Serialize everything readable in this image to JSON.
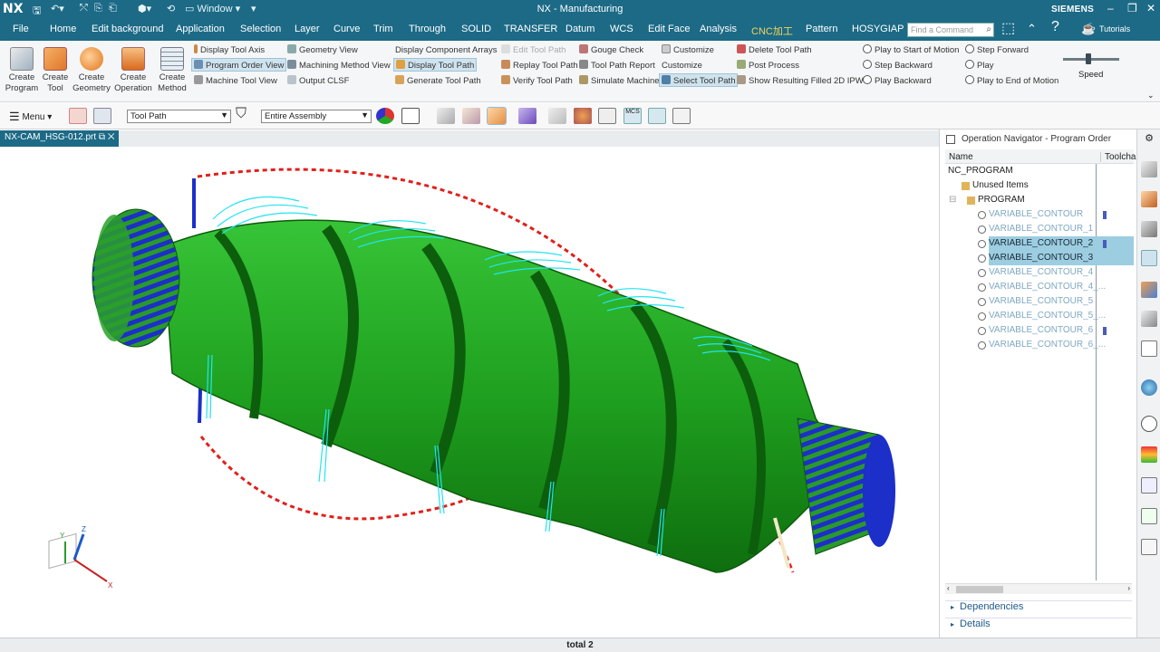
{
  "titlebar": {
    "logo": "NX",
    "window_menu": "Window",
    "title": "NX - Manufacturing",
    "brand": "SIEMENS"
  },
  "menubar": {
    "items": [
      "File",
      "Home",
      "Edit background",
      "Application",
      "Selection",
      "Layer",
      "Curve",
      "Trim",
      "Through",
      "SOLID",
      "TRANSFER",
      "Datum",
      "WCS",
      "Edit Face",
      "Analysis",
      "CNC加工",
      "Pattern",
      "HOSYGIAP"
    ],
    "active": "CNC加工",
    "search_placeholder": "Find a Command",
    "tutorials": "Tutorials"
  },
  "ribbon": {
    "create_program": [
      "Create",
      "Program"
    ],
    "create_tool": [
      "Create",
      "Tool"
    ],
    "create_geometry": [
      "Create",
      "Geometry"
    ],
    "create_operation": [
      "Create",
      "Operation"
    ],
    "create_method": [
      "Create",
      "Method"
    ],
    "display_tool_axis": "Display Tool Axis",
    "program_order_view": "Program Order View",
    "machine_tool_view": "Machine Tool View",
    "geometry_view": "Geometry View",
    "machining_method_view": "Machining Method View",
    "output_clsf": "Output CLSF",
    "display_component_arrays": "Display Component Arrays",
    "display_tool_path": "Display Tool Path",
    "generate_tool_path": "Generate Tool Path",
    "edit_tool_path": "Edit Tool Path",
    "replay_tool_path": "Replay Tool Path",
    "verify_tool_path": "Verify Tool Path",
    "gouge_check": "Gouge Check",
    "tool_path_report": "Tool Path Report",
    "simulate_machine": "Simulate Machine",
    "customize_1": "Customize",
    "customize_2": "Customize",
    "select_tool_path": "Select Tool Path",
    "delete_tool_path": "Delete Tool Path",
    "post_process": "Post Process",
    "show_resulting_ipw": "Show Resulting Filled 2D IPW",
    "play_to_start": "Play to Start of Motion",
    "step_backward": "Step Backward",
    "play_backward": "Play Backward",
    "step_forward": "Step Forward",
    "play": "Play",
    "play_to_end": "Play to End of Motion",
    "speed": "Speed",
    "speed_level": 0.45
  },
  "toolbar": {
    "menu_label": "Menu",
    "filter_value": "Tool Path",
    "assembly_value": "Entire Assembly"
  },
  "tab": {
    "name": "NX-CAM_HSG-012.prt"
  },
  "viewport": {
    "axis_labels": {
      "x": "X",
      "y": "Y",
      "z": "Z"
    }
  },
  "navigator": {
    "title": "Operation Navigator - Program Order",
    "col_name": "Name",
    "col_tool": "Toolcha",
    "root": "NC_PROGRAM",
    "unused": "Unused Items",
    "program": "PROGRAM",
    "operations": [
      {
        "name": "VARIABLE_CONTOUR",
        "tool_marker": true,
        "selected": false
      },
      {
        "name": "VARIABLE_CONTOUR_1",
        "tool_marker": false,
        "selected": false
      },
      {
        "name": "VARIABLE_CONTOUR_2",
        "tool_marker": true,
        "selected": true
      },
      {
        "name": "VARIABLE_CONTOUR_3",
        "tool_marker": false,
        "selected": true
      },
      {
        "name": "VARIABLE_CONTOUR_4",
        "tool_marker": false,
        "selected": false
      },
      {
        "name": "VARIABLE_CONTOUR_4_...",
        "tool_marker": false,
        "selected": false
      },
      {
        "name": "VARIABLE_CONTOUR_5",
        "tool_marker": false,
        "selected": false
      },
      {
        "name": "VARIABLE_CONTOUR_5_...",
        "tool_marker": false,
        "selected": false
      },
      {
        "name": "VARIABLE_CONTOUR_6",
        "tool_marker": true,
        "selected": false
      },
      {
        "name": "VARIABLE_CONTOUR_6_...",
        "tool_marker": false,
        "selected": false
      }
    ],
    "dependencies": "Dependencies",
    "details": "Details"
  },
  "status": {
    "text": "total 2"
  },
  "colors": {
    "titlebar": "#1c6a86",
    "part_green": "#1fa01f",
    "toolpath_cyan": "#22e4f0",
    "rapid_red": "#e0201c"
  }
}
